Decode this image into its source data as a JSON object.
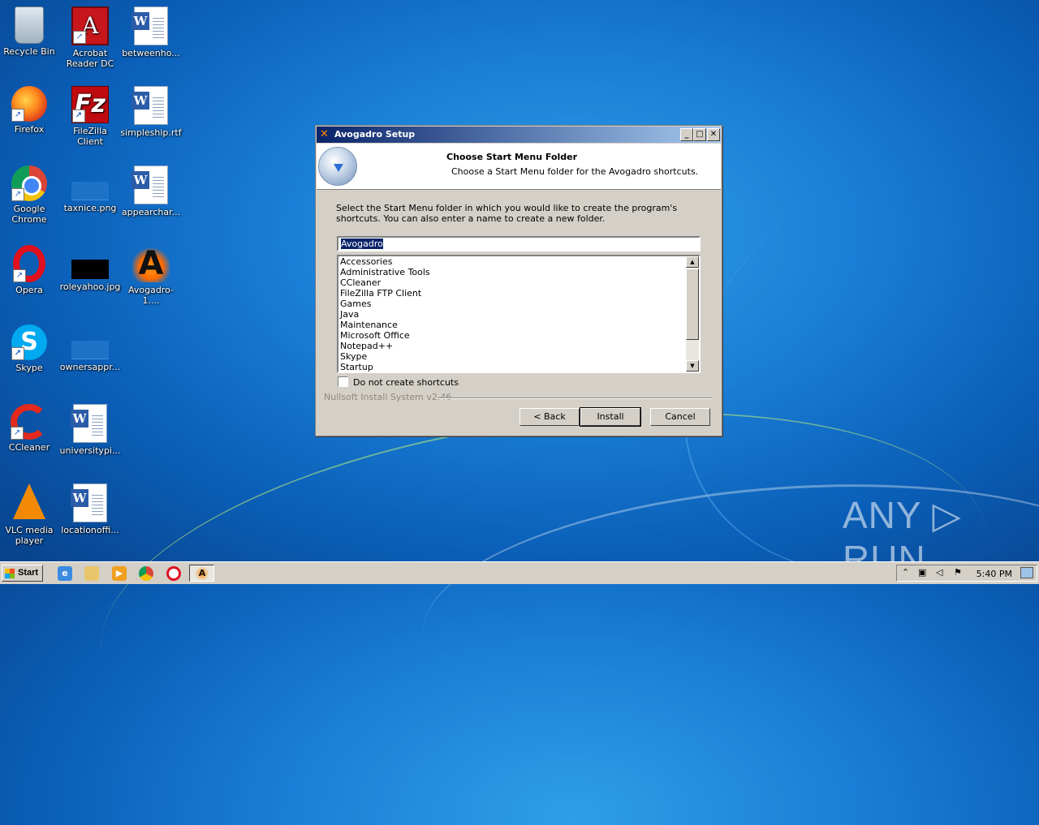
{
  "desktop": {
    "icons": [
      {
        "label": "Recycle Bin",
        "icon": "recycle-bin-icon"
      },
      {
        "label": "Acrobat Reader DC",
        "icon": "acrobat-icon"
      },
      {
        "label": "betweenho...",
        "icon": "word-doc-icon"
      },
      {
        "label": "Firefox",
        "icon": "firefox-icon"
      },
      {
        "label": "FileZilla Client",
        "icon": "filezilla-icon"
      },
      {
        "label": "simpleship.rtf",
        "icon": "word-doc-icon"
      },
      {
        "label": "Google Chrome",
        "icon": "chrome-icon"
      },
      {
        "label": "taxnice.png",
        "icon": "image-file-icon"
      },
      {
        "label": "appearchar...",
        "icon": "word-doc-icon"
      },
      {
        "label": "Opera",
        "icon": "opera-icon"
      },
      {
        "label": "roleyahoo.jpg",
        "icon": "image-file-icon"
      },
      {
        "label": "Avogadro-1....",
        "icon": "avogadro-installer-icon"
      },
      {
        "label": "Skype",
        "icon": "skype-icon"
      },
      {
        "label": "ownersappr...",
        "icon": "image-file-icon"
      },
      {
        "label": "CCleaner",
        "icon": "ccleaner-icon"
      },
      {
        "label": "universitypi...",
        "icon": "word-doc-icon"
      },
      {
        "label": "VLC media player",
        "icon": "vlc-icon"
      },
      {
        "label": "locationoffi...",
        "icon": "word-doc-icon"
      }
    ]
  },
  "dialog": {
    "title": "Avogadro Setup",
    "header_title": "Choose Start Menu Folder",
    "header_subtitle": "Choose a Start Menu folder for the Avogadro shortcuts.",
    "description": "Select the Start Menu folder in which you would like to create the program's shortcuts. You can also enter a name to create a new folder.",
    "folder_value": "Avogadro",
    "folders": [
      "Accessories",
      "Administrative Tools",
      "CCleaner",
      "FileZilla FTP Client",
      "Games",
      "Java",
      "Maintenance",
      "Microsoft Office",
      "Notepad++",
      "Skype",
      "Startup"
    ],
    "checkbox_label": "Do not create shortcuts",
    "checkbox_checked": false,
    "branding": "Nullsoft Install System v2.46",
    "back_label": "< Back",
    "install_label": "Install",
    "cancel_label": "Cancel"
  },
  "watermark": "ANY ▷ RUN",
  "taskbar": {
    "start_label": "Start",
    "clock": "5:40 PM",
    "pinned": [
      "internet-explorer-icon",
      "explorer-icon",
      "media-player-icon",
      "chrome-icon",
      "opera-icon",
      "avogadro-icon"
    ]
  }
}
